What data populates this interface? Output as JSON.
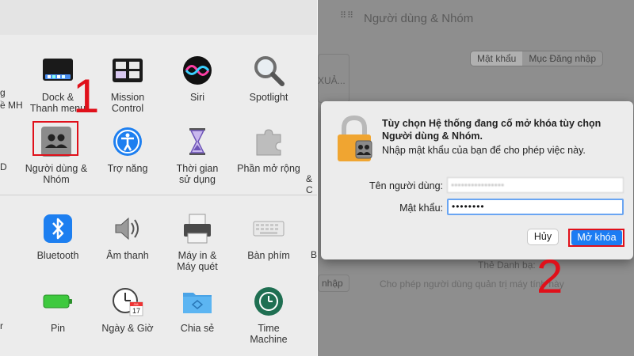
{
  "left": {
    "row1": [
      {
        "name": "dock",
        "label": "Dock &\nThanh menu"
      },
      {
        "name": "mission-control",
        "label": "Mission\nControl"
      },
      {
        "name": "siri",
        "label": "Siri"
      },
      {
        "name": "spotlight",
        "label": "Spotlight"
      }
    ],
    "row2": [
      {
        "name": "users-groups",
        "label": "Người dùng &\nNhóm"
      },
      {
        "name": "accessibility",
        "label": "Trợ năng"
      },
      {
        "name": "screen-time",
        "label": "Thời gian\nsử dụng"
      },
      {
        "name": "extensions",
        "label": "Phần mở rộng"
      }
    ],
    "row3": [
      {
        "name": "bluetooth",
        "label": "Bluetooth"
      },
      {
        "name": "sound",
        "label": "Âm thanh"
      },
      {
        "name": "printers",
        "label": "Máy in &\nMáy quét"
      },
      {
        "name": "keyboard",
        "label": "Bàn phím"
      }
    ],
    "row4": [
      {
        "name": "battery",
        "label": "Pin"
      },
      {
        "name": "date-time",
        "label": "Ngày & Giờ"
      },
      {
        "name": "sharing",
        "label": "Chia sẻ"
      },
      {
        "name": "time-machine",
        "label": "Time\nMachine"
      }
    ],
    "fragments": {
      "f1": "g",
      "f2": "ề MH",
      "f3": "D",
      "f4": "& C",
      "f5": "B",
      "f6": "r"
    },
    "calendar_month": "JUL",
    "calendar_day": "17",
    "step1": "1"
  },
  "right": {
    "title": "Người dùng & Nhóm",
    "tabs": [
      "Mật khẩu",
      "Mục Đăng nhập"
    ],
    "bg_text_1": "XUẢ...",
    "bg_text_2": "Thẻ Danh bạ:",
    "bg_text_3": "Cho phép người dùng quản trị máy tính này",
    "bg_button": "nhập",
    "dialog": {
      "title": "Tùy chọn Hệ thống đang cố mở khóa tùy chọn Người dùng & Nhóm.",
      "message": "Nhập mật khẩu của bạn để cho phép việc này.",
      "username_label": "Tên người dùng:",
      "username_value": "••••••••••••••••",
      "password_label": "Mật khẩu:",
      "password_value": "••••••••",
      "cancel_label": "Hủy",
      "unlock_label": "Mở khóa"
    },
    "step2": "2"
  },
  "colors": {
    "highlight": "#e0101a",
    "accent": "#1b7cf3"
  }
}
